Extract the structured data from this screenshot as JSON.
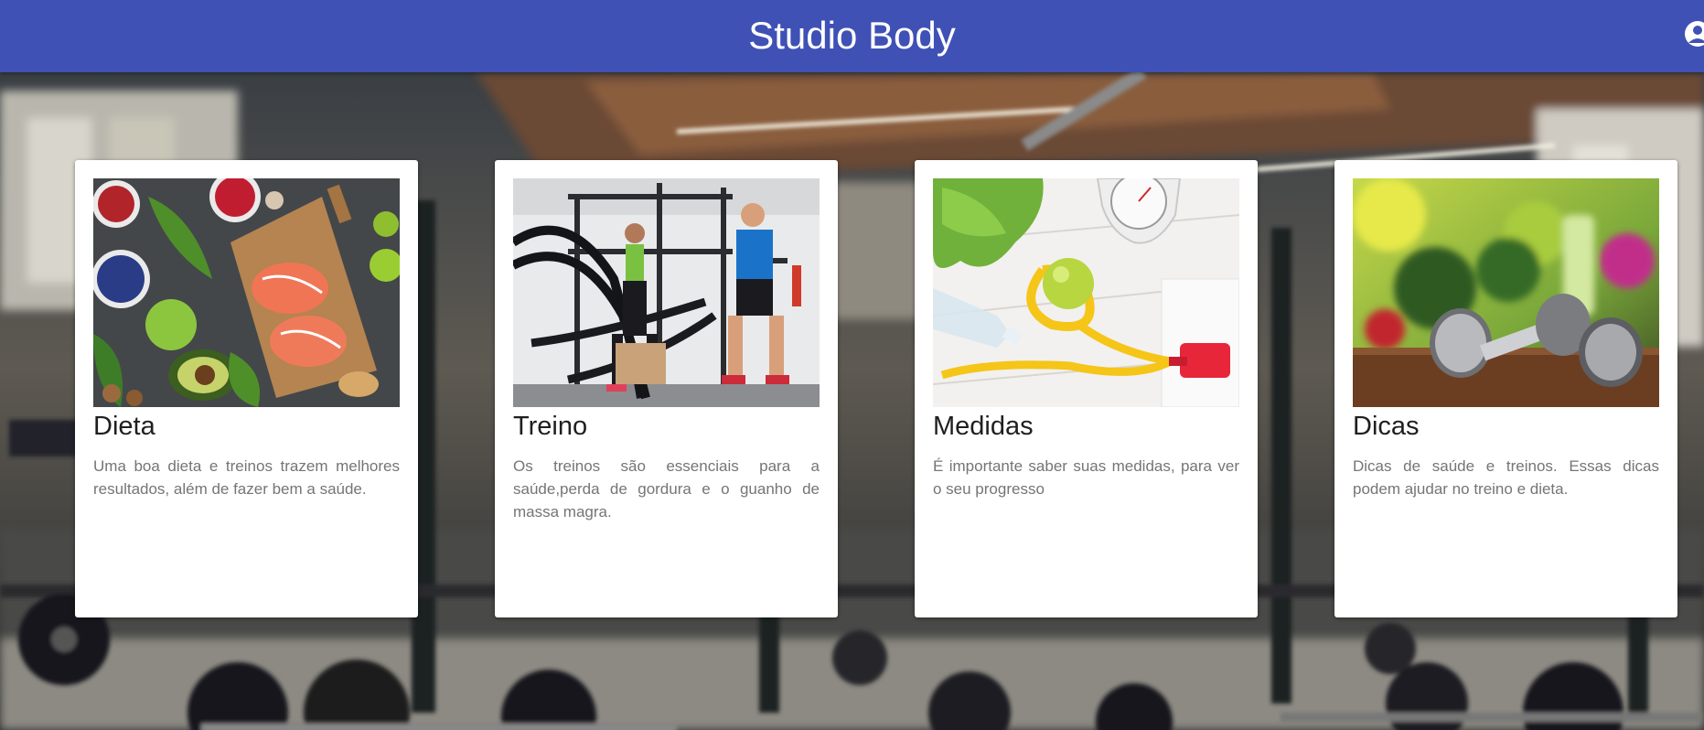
{
  "header": {
    "title": "Studio Body",
    "icon": "account-icon"
  },
  "cards": [
    {
      "title": "Dieta",
      "text": "Uma boa dieta e treinos trazem melhores resultados, além de fazer bem a saúde.",
      "image": "healthy-food-photo"
    },
    {
      "title": "Treino",
      "text": "Os treinos são essenciais para a saúde,perda de gordura e o guanho de massa magra.",
      "image": "battle-ropes-workout-photo"
    },
    {
      "title": "Medidas",
      "text": "É importante saber suas medidas, para ver o seu progresso",
      "image": "measuring-tape-scale-photo"
    },
    {
      "title": "Dicas",
      "text": "Dicas de saúde e treinos. Essas dicas podem ajudar no treino e dieta.",
      "image": "dumbbells-vegetables-photo"
    }
  ],
  "colors": {
    "header": "#3f51b5",
    "card_bg": "#ffffff",
    "card_title": "#1f1f1f",
    "card_text": "#757575"
  }
}
